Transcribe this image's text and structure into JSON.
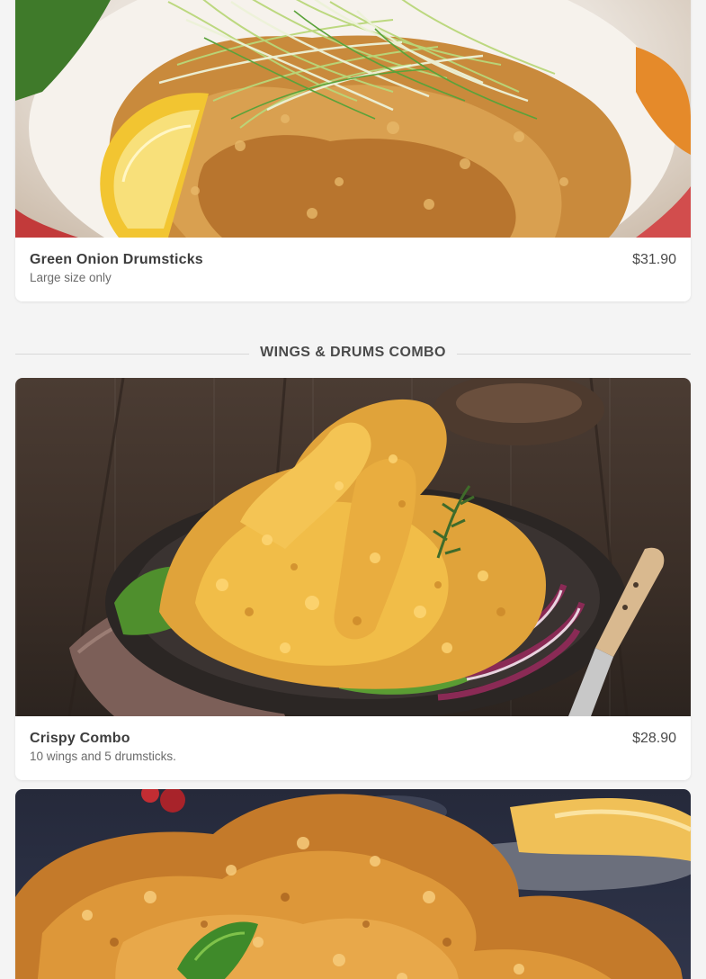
{
  "items": [
    {
      "name": "Green Onion Drumsticks",
      "description": "Large size only",
      "price": "$31.90",
      "image": "fried-chicken-with-green-onion-and-lemon"
    },
    {
      "name": "Crispy Combo",
      "description": "10 wings and 5 drumsticks.",
      "price": "$28.90",
      "image": "crispy-fried-chicken-plate-with-knife"
    },
    {
      "image": "glazed-fried-chicken-with-lettuce"
    }
  ],
  "section": {
    "title": "WINGS & DRUMS COMBO"
  },
  "colors": {
    "page_background": "#f4f4f4",
    "card_background": "#ffffff",
    "text_primary": "#3d3d3d",
    "text_secondary": "#6b6b6b",
    "divider": "#d8d8d8"
  }
}
